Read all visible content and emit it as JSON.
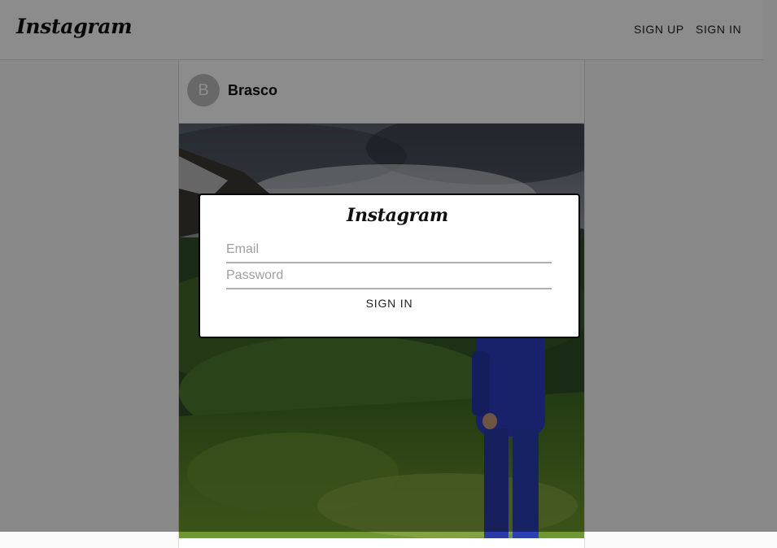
{
  "header": {
    "logo_text": "Instagram",
    "sign_up_label": "SIGN UP",
    "sign_in_label": "SIGN IN"
  },
  "post": {
    "avatar_letter": "B",
    "username": "Brasco",
    "image_alt": "Photo of a person in a blue tracksuit standing on a mountain slope with forest and cloudy sky"
  },
  "modal": {
    "logo_text": "Instagram",
    "email_placeholder": "Email",
    "password_placeholder": "Password",
    "sign_in_label": "SIGN IN"
  },
  "colors": {
    "overlay": "#000000",
    "border": "#dbdbdb",
    "tracksuit": "#2a3fc4"
  }
}
